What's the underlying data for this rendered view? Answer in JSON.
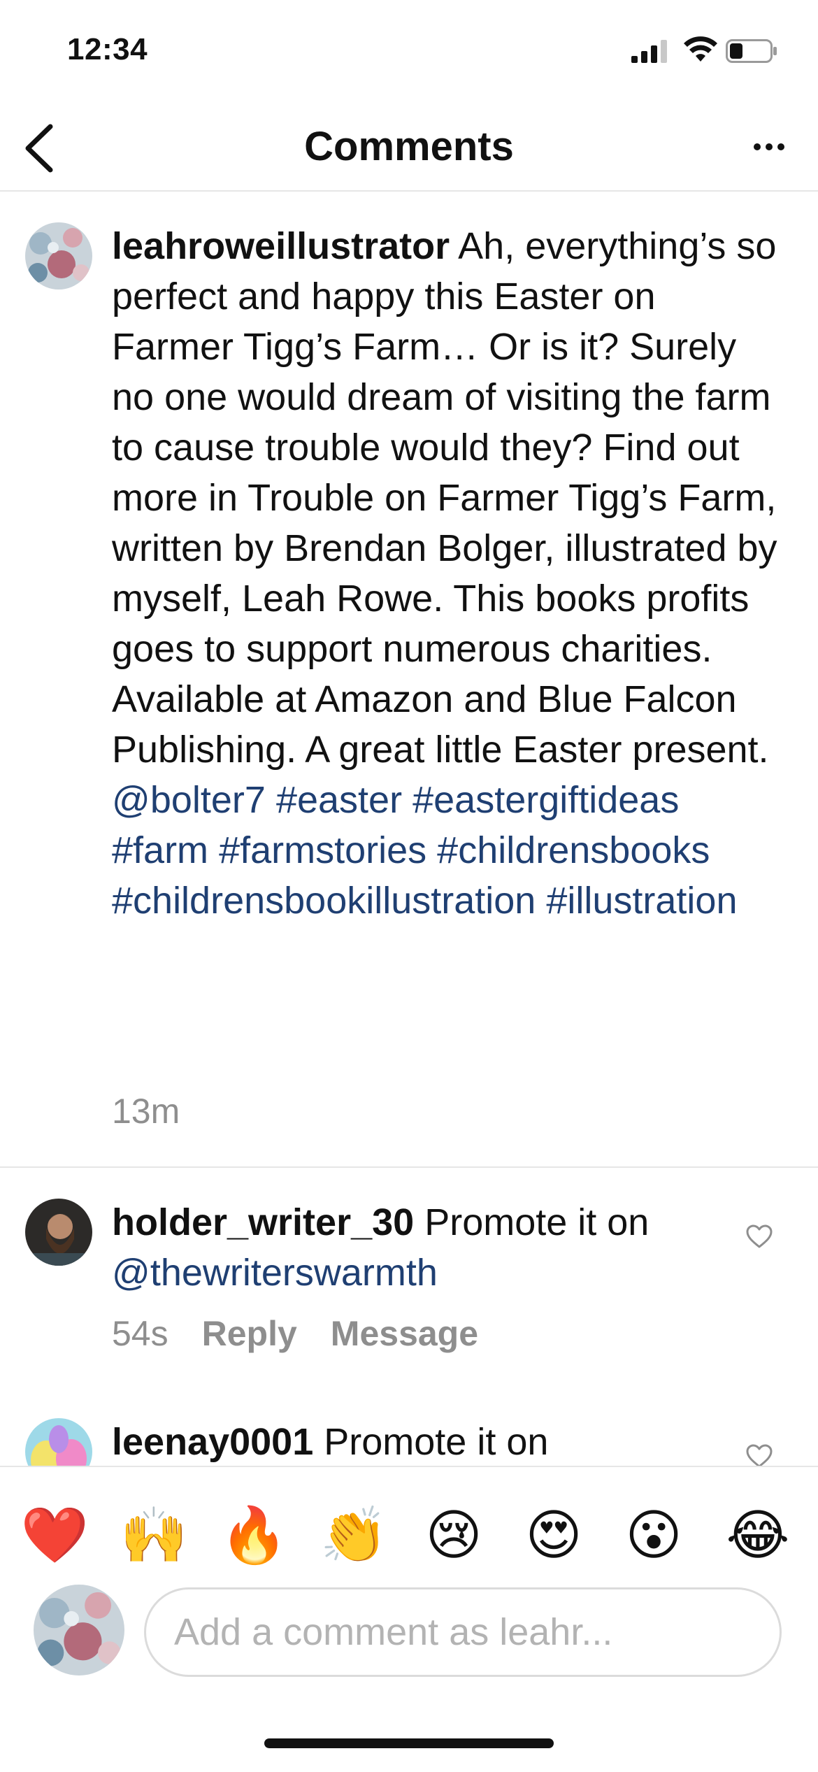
{
  "status_bar": {
    "time": "12:34",
    "icons": [
      "cellular-signal-icon",
      "wifi-icon",
      "battery-icon"
    ]
  },
  "header": {
    "title": "Comments",
    "back_icon": "chevron-left-icon",
    "more_icon": "more-horizontal-icon",
    "more_label": "···"
  },
  "post": {
    "username": "leahroweillustrator",
    "text": " Ah, everything’s so perfect and happy this Easter on Farmer Tigg’s Farm… Or is it? Surely no one would dream of visiting the farm to cause trouble would they? Find out more in Trouble on Farmer Tigg’s Farm, written by Brendan Bolger, illustrated by myself, Leah Rowe. This books profits goes to support numerous charities. Available at Amazon and Blue Falcon Publishing. A great little Easter present. ",
    "mention": "@bolter7",
    "hashtags": [
      "#easter",
      "#eastergiftideas",
      "#farm",
      "#farmstories",
      "#childrensbooks",
      "#childrensbookillustration",
      "#illustration"
    ],
    "time": "13m"
  },
  "comments": [
    {
      "username": "holder_writer_30",
      "text": " Promote it on ",
      "mention": "@thewriterswarmth",
      "time": "54s",
      "reply_label": "Reply",
      "message_label": "Message"
    },
    {
      "username": "leenay0001",
      "text": " Promote it on"
    }
  ],
  "emoji_bar": [
    "❤️",
    "🙌",
    "🔥",
    "👏",
    "😢",
    "😍",
    "😮",
    "😂"
  ],
  "comment_input": {
    "placeholder": "Add a comment as leahr...",
    "value": ""
  },
  "colors": {
    "link": "#1f3f72",
    "muted": "#8e8e8e",
    "divider": "#e6e6e6"
  }
}
